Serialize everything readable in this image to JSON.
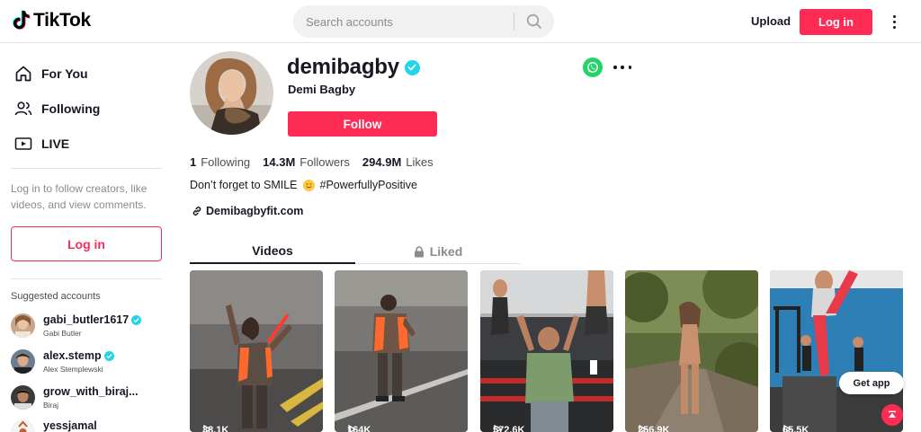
{
  "header": {
    "logo_text": "TikTok",
    "search_placeholder": "Search accounts",
    "upload_label": "Upload",
    "login_label": "Log in"
  },
  "sidebar": {
    "nav": [
      {
        "label": "For You",
        "icon": "home-icon"
      },
      {
        "label": "Following",
        "icon": "users-icon"
      },
      {
        "label": "LIVE",
        "icon": "live-icon"
      }
    ],
    "hint": "Log in to follow creators, like videos, and view comments.",
    "login_label": "Log in",
    "suggested_title": "Suggested accounts",
    "suggested": [
      {
        "handle": "gabi_butler1617",
        "name": "Gabi Butler",
        "verified": true
      },
      {
        "handle": "alex.stemp",
        "name": "Alex Stemplewski",
        "verified": true
      },
      {
        "handle": "grow_with_biraj...",
        "name": "Biraj",
        "verified": false
      },
      {
        "handle": "yessjamal",
        "name": "",
        "verified": false
      }
    ]
  },
  "profile": {
    "username": "demibagby",
    "display_name": "Demi Bagby",
    "follow_label": "Follow",
    "stats": {
      "following_num": "1",
      "following_label": "Following",
      "followers_num": "14.3M",
      "followers_label": "Followers",
      "likes_num": "294.9M",
      "likes_label": "Likes"
    },
    "bio_before": "Don’t forget to SMILE",
    "bio_after": "#PowerfullyPositive",
    "link": "Demibagbyfit.com"
  },
  "tabs": {
    "videos": "Videos",
    "liked": "Liked"
  },
  "videos": [
    {
      "views": "38.1K"
    },
    {
      "views": "164K"
    },
    {
      "views": "572.6K"
    },
    {
      "views": "256.9K"
    },
    {
      "views": "65.5K"
    }
  ],
  "floating": {
    "get_app": "Get app"
  },
  "colors": {
    "accent": "#fe2c55",
    "verified": "#20d5ec",
    "whatsapp": "#25d366"
  }
}
